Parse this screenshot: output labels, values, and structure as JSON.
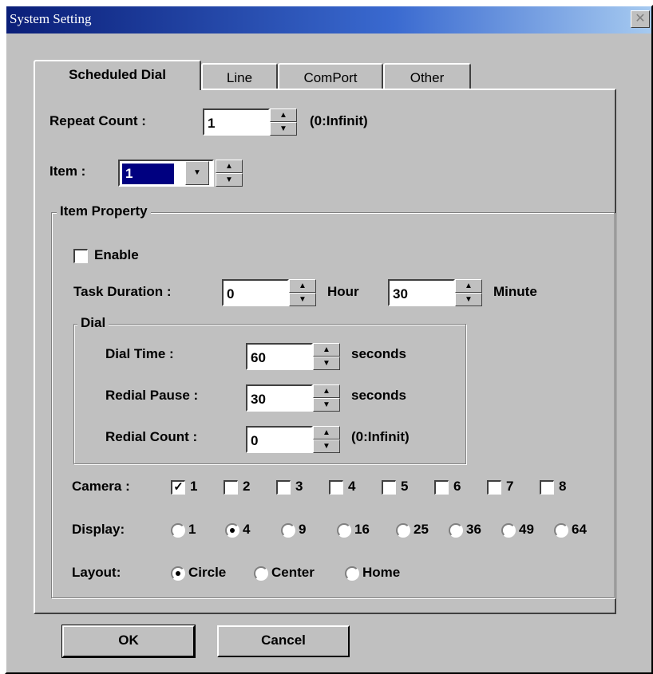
{
  "window": {
    "title": "System Setting",
    "close_glyph": "✕"
  },
  "tabs": [
    "Scheduled Dial",
    "Line",
    "ComPort",
    "Other"
  ],
  "repeat_count": {
    "label": "Repeat Count :",
    "value": "1",
    "hint": "(0:Infinit)"
  },
  "item": {
    "label": "Item :",
    "value": "1"
  },
  "item_property": {
    "legend": "Item Property",
    "enable_label": "Enable",
    "enable_checked": false,
    "task_duration": {
      "label": "Task Duration :",
      "hour_value": "0",
      "hour_unit": "Hour",
      "minute_value": "30",
      "minute_unit": "Minute"
    },
    "dial": {
      "legend": "Dial",
      "dial_time": {
        "label": "Dial Time :",
        "value": "60",
        "unit": "seconds"
      },
      "redial_pause": {
        "label": "Redial Pause :",
        "value": "30",
        "unit": "seconds"
      },
      "redial_count": {
        "label": "Redial Count :",
        "value": "0",
        "unit": "(0:Infinit)"
      }
    },
    "camera": {
      "label": "Camera :",
      "options": [
        "1",
        "2",
        "3",
        "4",
        "5",
        "6",
        "7",
        "8"
      ],
      "checked": [
        true,
        false,
        false,
        false,
        false,
        false,
        false,
        false
      ]
    },
    "display": {
      "label": "Display:",
      "options": [
        "1",
        "4",
        "9",
        "16",
        "25",
        "36",
        "49",
        "64"
      ],
      "selected": "4"
    },
    "layout": {
      "label": "Layout:",
      "options": [
        "Circle",
        "Center",
        "Home"
      ],
      "selected": "Circle"
    }
  },
  "buttons": {
    "ok": "OK",
    "cancel": "Cancel"
  }
}
